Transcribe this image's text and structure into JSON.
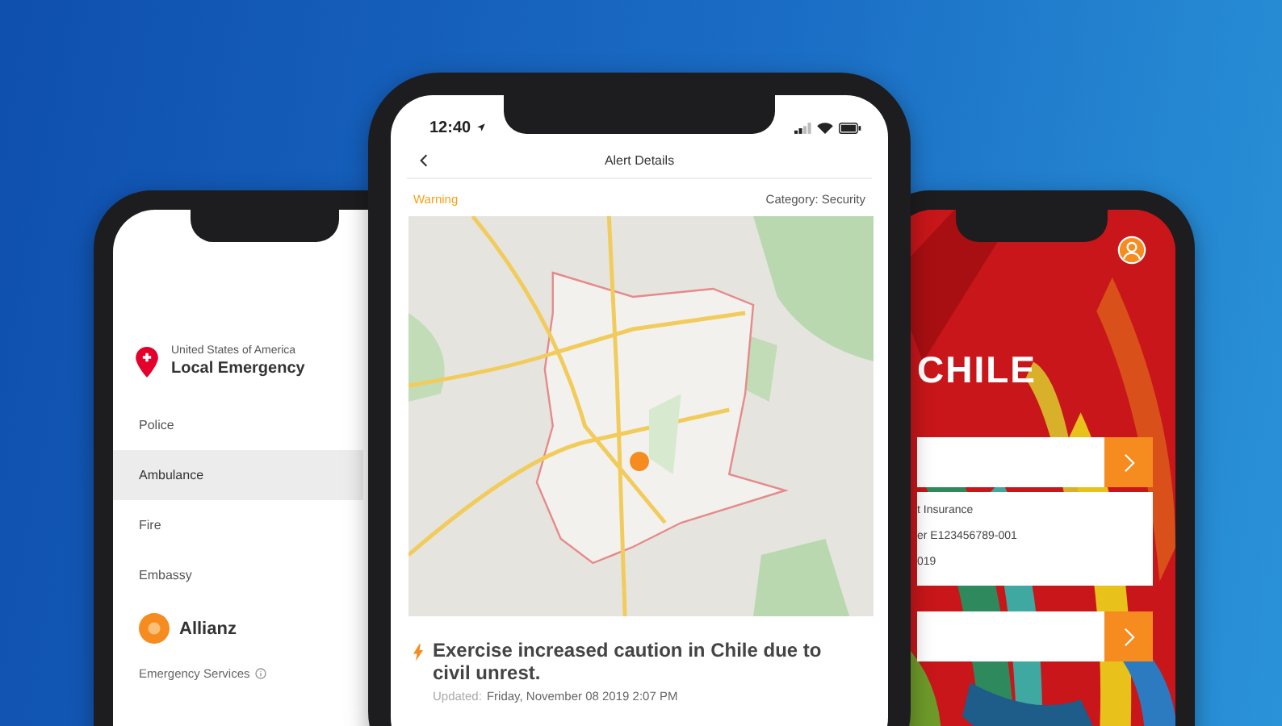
{
  "left_phone": {
    "location": {
      "country": "United States of America",
      "title": "Local Emergency"
    },
    "contacts": [
      {
        "label": "Police",
        "selected": false
      },
      {
        "label": "Ambulance",
        "selected": true
      },
      {
        "label": "Fire",
        "selected": false
      },
      {
        "label": "Embassy",
        "selected": false
      }
    ],
    "provider": {
      "name": "Allianz"
    },
    "services_label": "Emergency Services"
  },
  "center_phone": {
    "status_bar": {
      "time": "12:40"
    },
    "title": "Alert Details",
    "severity": "Warning",
    "category": "Category: Security",
    "alert": {
      "headline": "Exercise increased caution in Chile due to civil unrest.",
      "updated_label": "Updated:",
      "updated": "Friday, November 08 2019 2:07 PM"
    }
  },
  "right_phone": {
    "country": "CHILE",
    "cards": [
      {
        "kind": "action"
      },
      {
        "kind": "details",
        "lines": [
          "t Insurance",
          "er E123456789-001",
          "019"
        ]
      },
      {
        "kind": "action"
      }
    ]
  }
}
